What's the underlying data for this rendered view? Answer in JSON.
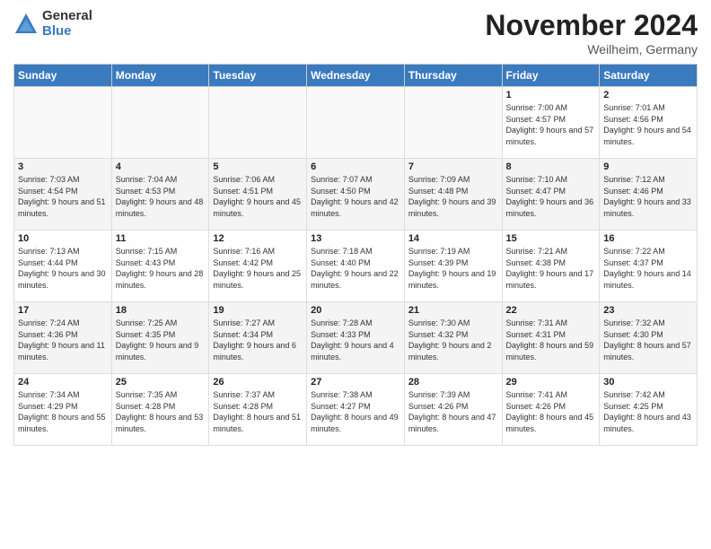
{
  "header": {
    "logo_general": "General",
    "logo_blue": "Blue",
    "month_title": "November 2024",
    "location": "Weilheim, Germany"
  },
  "days_of_week": [
    "Sunday",
    "Monday",
    "Tuesday",
    "Wednesday",
    "Thursday",
    "Friday",
    "Saturday"
  ],
  "weeks": [
    [
      {
        "day": "",
        "info": ""
      },
      {
        "day": "",
        "info": ""
      },
      {
        "day": "",
        "info": ""
      },
      {
        "day": "",
        "info": ""
      },
      {
        "day": "",
        "info": ""
      },
      {
        "day": "1",
        "info": "Sunrise: 7:00 AM\nSunset: 4:57 PM\nDaylight: 9 hours and 57 minutes."
      },
      {
        "day": "2",
        "info": "Sunrise: 7:01 AM\nSunset: 4:56 PM\nDaylight: 9 hours and 54 minutes."
      }
    ],
    [
      {
        "day": "3",
        "info": "Sunrise: 7:03 AM\nSunset: 4:54 PM\nDaylight: 9 hours and 51 minutes."
      },
      {
        "day": "4",
        "info": "Sunrise: 7:04 AM\nSunset: 4:53 PM\nDaylight: 9 hours and 48 minutes."
      },
      {
        "day": "5",
        "info": "Sunrise: 7:06 AM\nSunset: 4:51 PM\nDaylight: 9 hours and 45 minutes."
      },
      {
        "day": "6",
        "info": "Sunrise: 7:07 AM\nSunset: 4:50 PM\nDaylight: 9 hours and 42 minutes."
      },
      {
        "day": "7",
        "info": "Sunrise: 7:09 AM\nSunset: 4:48 PM\nDaylight: 9 hours and 39 minutes."
      },
      {
        "day": "8",
        "info": "Sunrise: 7:10 AM\nSunset: 4:47 PM\nDaylight: 9 hours and 36 minutes."
      },
      {
        "day": "9",
        "info": "Sunrise: 7:12 AM\nSunset: 4:46 PM\nDaylight: 9 hours and 33 minutes."
      }
    ],
    [
      {
        "day": "10",
        "info": "Sunrise: 7:13 AM\nSunset: 4:44 PM\nDaylight: 9 hours and 30 minutes."
      },
      {
        "day": "11",
        "info": "Sunrise: 7:15 AM\nSunset: 4:43 PM\nDaylight: 9 hours and 28 minutes."
      },
      {
        "day": "12",
        "info": "Sunrise: 7:16 AM\nSunset: 4:42 PM\nDaylight: 9 hours and 25 minutes."
      },
      {
        "day": "13",
        "info": "Sunrise: 7:18 AM\nSunset: 4:40 PM\nDaylight: 9 hours and 22 minutes."
      },
      {
        "day": "14",
        "info": "Sunrise: 7:19 AM\nSunset: 4:39 PM\nDaylight: 9 hours and 19 minutes."
      },
      {
        "day": "15",
        "info": "Sunrise: 7:21 AM\nSunset: 4:38 PM\nDaylight: 9 hours and 17 minutes."
      },
      {
        "day": "16",
        "info": "Sunrise: 7:22 AM\nSunset: 4:37 PM\nDaylight: 9 hours and 14 minutes."
      }
    ],
    [
      {
        "day": "17",
        "info": "Sunrise: 7:24 AM\nSunset: 4:36 PM\nDaylight: 9 hours and 11 minutes."
      },
      {
        "day": "18",
        "info": "Sunrise: 7:25 AM\nSunset: 4:35 PM\nDaylight: 9 hours and 9 minutes."
      },
      {
        "day": "19",
        "info": "Sunrise: 7:27 AM\nSunset: 4:34 PM\nDaylight: 9 hours and 6 minutes."
      },
      {
        "day": "20",
        "info": "Sunrise: 7:28 AM\nSunset: 4:33 PM\nDaylight: 9 hours and 4 minutes."
      },
      {
        "day": "21",
        "info": "Sunrise: 7:30 AM\nSunset: 4:32 PM\nDaylight: 9 hours and 2 minutes."
      },
      {
        "day": "22",
        "info": "Sunrise: 7:31 AM\nSunset: 4:31 PM\nDaylight: 8 hours and 59 minutes."
      },
      {
        "day": "23",
        "info": "Sunrise: 7:32 AM\nSunset: 4:30 PM\nDaylight: 8 hours and 57 minutes."
      }
    ],
    [
      {
        "day": "24",
        "info": "Sunrise: 7:34 AM\nSunset: 4:29 PM\nDaylight: 8 hours and 55 minutes."
      },
      {
        "day": "25",
        "info": "Sunrise: 7:35 AM\nSunset: 4:28 PM\nDaylight: 8 hours and 53 minutes."
      },
      {
        "day": "26",
        "info": "Sunrise: 7:37 AM\nSunset: 4:28 PM\nDaylight: 8 hours and 51 minutes."
      },
      {
        "day": "27",
        "info": "Sunrise: 7:38 AM\nSunset: 4:27 PM\nDaylight: 8 hours and 49 minutes."
      },
      {
        "day": "28",
        "info": "Sunrise: 7:39 AM\nSunset: 4:26 PM\nDaylight: 8 hours and 47 minutes."
      },
      {
        "day": "29",
        "info": "Sunrise: 7:41 AM\nSunset: 4:26 PM\nDaylight: 8 hours and 45 minutes."
      },
      {
        "day": "30",
        "info": "Sunrise: 7:42 AM\nSunset: 4:25 PM\nDaylight: 8 hours and 43 minutes."
      }
    ]
  ]
}
